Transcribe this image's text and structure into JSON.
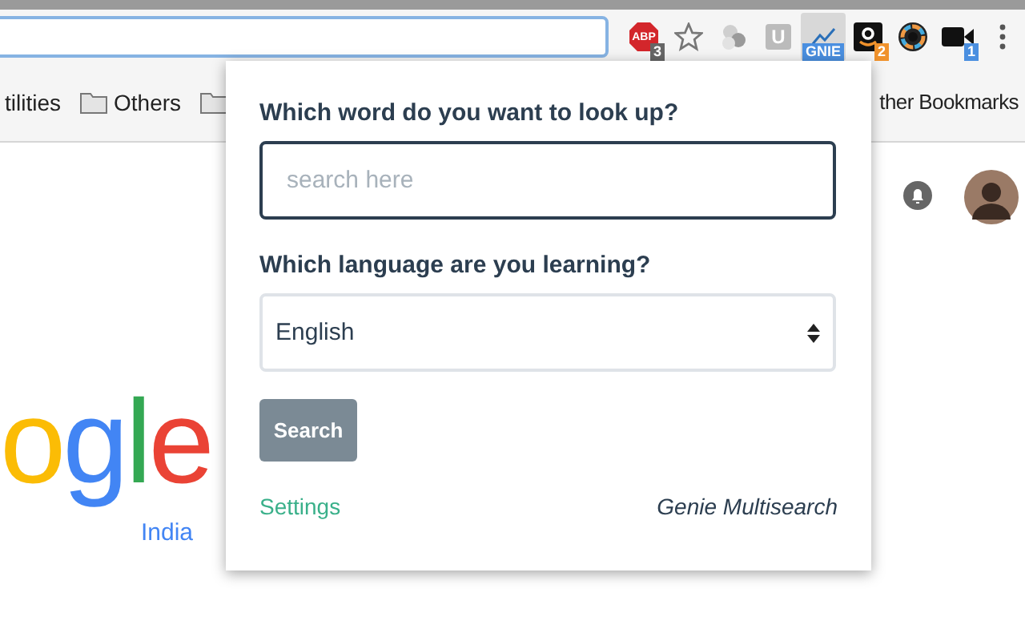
{
  "toolbar": {
    "extensions": [
      {
        "kind": "abp",
        "label": "ABP",
        "badge": "3",
        "color": "#666666",
        "selected": false
      },
      {
        "kind": "star",
        "selected": false
      },
      {
        "kind": "balls",
        "selected": false
      },
      {
        "kind": "letter",
        "label": "U",
        "selected": false
      },
      {
        "kind": "genie",
        "badge": "GNIE",
        "color": "#4a8fe0",
        "selected": true
      },
      {
        "kind": "amazon",
        "badge": "2",
        "color": "#f0922c",
        "selected": false
      },
      {
        "kind": "wheel",
        "selected": false
      },
      {
        "kind": "camera",
        "badge": "1",
        "color": "#4a8fe0",
        "selected": false
      },
      {
        "kind": "menu",
        "selected": false
      }
    ]
  },
  "bookmarks": {
    "items": [
      {
        "kind": "text",
        "label": "tilities"
      },
      {
        "kind": "folder",
        "label": "Others"
      },
      {
        "kind": "folder"
      }
    ],
    "other": "ther Bookmarks"
  },
  "popup": {
    "word_label": "Which word do you want to look up?",
    "search_field": {
      "placeholder": "search here"
    },
    "language_label": "Which language are you learning?",
    "language_select": {
      "value": "English"
    },
    "search_button": "Search",
    "settings_link": "Settings",
    "brand": "Genie Multisearch"
  },
  "page": {
    "logo": "ogle",
    "region": "India"
  }
}
